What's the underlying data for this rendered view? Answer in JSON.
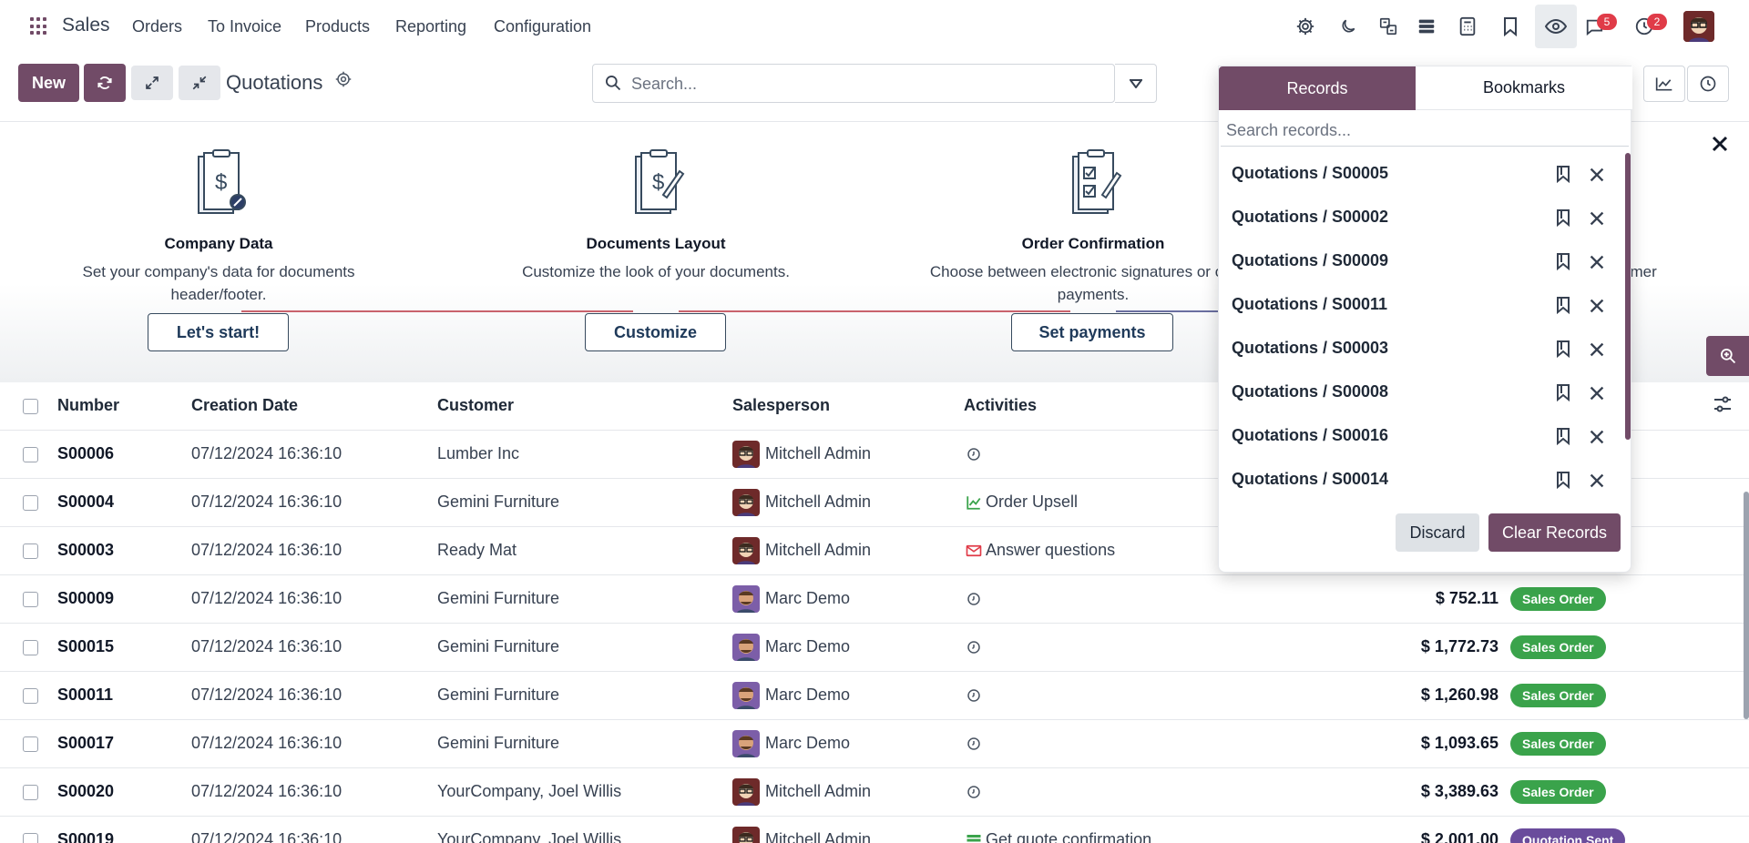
{
  "topnav": {
    "app_name": "Sales",
    "menus": [
      "Orders",
      "To Invoice",
      "Products",
      "Reporting",
      "Configuration"
    ],
    "icons": [
      "gear-icon",
      "moon-icon",
      "translate-icon",
      "database-icon",
      "calculator-icon",
      "bookmark-icon",
      "eye-icon",
      "chat-icon",
      "clock-icon"
    ],
    "chat_count": "5",
    "activity_count": "2"
  },
  "control": {
    "new_label": "New",
    "title": "Quotations",
    "search_placeholder": "Search..."
  },
  "onboarding": [
    {
      "title": "Company Data",
      "desc": "Set your company's data for documents header/footer.",
      "button": "Let's start!"
    },
    {
      "title": "Documents Layout",
      "desc": "Customize the look of your documents.",
      "button": "Customize"
    },
    {
      "title": "Order Confirmation",
      "desc": "Choose between electronic signatures or online payments.",
      "button": "Set payments"
    },
    {
      "title": "",
      "desc": "omer",
      "button": ""
    }
  ],
  "table": {
    "headers": [
      "Number",
      "Creation Date",
      "Customer",
      "Salesperson",
      "Activities"
    ],
    "rows": [
      {
        "number": "S00006",
        "date": "07/12/2024 16:36:10",
        "customer": "Lumber Inc",
        "salesperson": "Mitchell Admin",
        "activity": "",
        "activity_icon": "clock-icon",
        "amount": "",
        "status": ""
      },
      {
        "number": "S00004",
        "date": "07/12/2024 16:36:10",
        "customer": "Gemini Furniture",
        "salesperson": "Mitchell Admin",
        "activity": "Order Upsell",
        "activity_icon": "chart-icon",
        "amount": "",
        "status": ""
      },
      {
        "number": "S00003",
        "date": "07/12/2024 16:36:10",
        "customer": "Ready Mat",
        "salesperson": "Mitchell Admin",
        "activity": "Answer questions",
        "activity_icon": "envelope-icon",
        "amount": "",
        "status": ""
      },
      {
        "number": "S00009",
        "date": "07/12/2024 16:36:10",
        "customer": "Gemini Furniture",
        "salesperson": "Marc Demo",
        "activity": "",
        "activity_icon": "clock-icon",
        "amount": "$ 752.11",
        "status": "Sales Order"
      },
      {
        "number": "S00015",
        "date": "07/12/2024 16:36:10",
        "customer": "Gemini Furniture",
        "salesperson": "Marc Demo",
        "activity": "",
        "activity_icon": "clock-icon",
        "amount": "$ 1,772.73",
        "status": "Sales Order"
      },
      {
        "number": "S00011",
        "date": "07/12/2024 16:36:10",
        "customer": "Gemini Furniture",
        "salesperson": "Marc Demo",
        "activity": "",
        "activity_icon": "clock-icon",
        "amount": "$ 1,260.98",
        "status": "Sales Order"
      },
      {
        "number": "S00017",
        "date": "07/12/2024 16:36:10",
        "customer": "Gemini Furniture",
        "salesperson": "Marc Demo",
        "activity": "",
        "activity_icon": "clock-icon",
        "amount": "$ 1,093.65",
        "status": "Sales Order"
      },
      {
        "number": "S00020",
        "date": "07/12/2024 16:36:10",
        "customer": "YourCompany, Joel Willis",
        "salesperson": "Mitchell Admin",
        "activity": "",
        "activity_icon": "clock-icon",
        "amount": "$ 3,389.63",
        "status": "Sales Order"
      },
      {
        "number": "S00019",
        "date": "07/12/2024 16:36:10",
        "customer": "YourCompany, Joel Willis",
        "salesperson": "Mitchell Admin",
        "activity": "Get quote confirmation",
        "activity_icon": "list-icon",
        "amount": "$ 2,001.00",
        "status": "Quotation Sent"
      }
    ]
  },
  "popover": {
    "tab_records": "Records",
    "tab_bookmarks": "Bookmarks",
    "search_placeholder": "Search records...",
    "items": [
      "Quotations / S00005",
      "Quotations / S00002",
      "Quotations / S00009",
      "Quotations / S00011",
      "Quotations / S00003",
      "Quotations / S00008",
      "Quotations / S00016",
      "Quotations / S00014"
    ],
    "discard_label": "Discard",
    "clear_label": "Clear Records"
  },
  "colors": {
    "brand": "#714b67",
    "sales_order": "#3aa34b",
    "quotation_sent": "#6a4c9c",
    "badge_red": "#e03b48"
  }
}
